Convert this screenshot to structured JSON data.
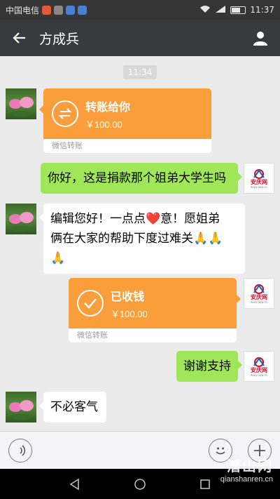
{
  "status_bar": {
    "carrier": "中国电信",
    "time": "11:37"
  },
  "header": {
    "title": "方成兵"
  },
  "chat": {
    "timestamp": "11:34",
    "messages": [
      {
        "side": "left",
        "kind": "transfer",
        "title": "转账给你",
        "amount": "￥100.00",
        "footer": "微信转账"
      },
      {
        "side": "right",
        "kind": "text",
        "text": "你好，这是捐款那个姐弟大学生吗"
      },
      {
        "side": "left",
        "kind": "text",
        "text_line1": "编辑您好！一点点",
        "text_heart": "❤️",
        "text_line1b": "意！愿姐弟",
        "text_line2": "俩在大家的帮助下度过难关",
        "text_pray": "🙏🙏",
        "text_line3": "🙏"
      },
      {
        "side": "right",
        "kind": "transfer",
        "title": "已收钱",
        "amount": "￥100.00",
        "footer": "微信转账"
      },
      {
        "side": "right",
        "kind": "text",
        "text": "谢谢支持"
      },
      {
        "side": "left",
        "kind": "text",
        "text": "不必客气"
      }
    ],
    "logo": {
      "text": "安庆网",
      "url": "www.aqw.cc"
    }
  },
  "watermark": {
    "logo": "潜山网",
    "url": "qianshanren.cn"
  }
}
